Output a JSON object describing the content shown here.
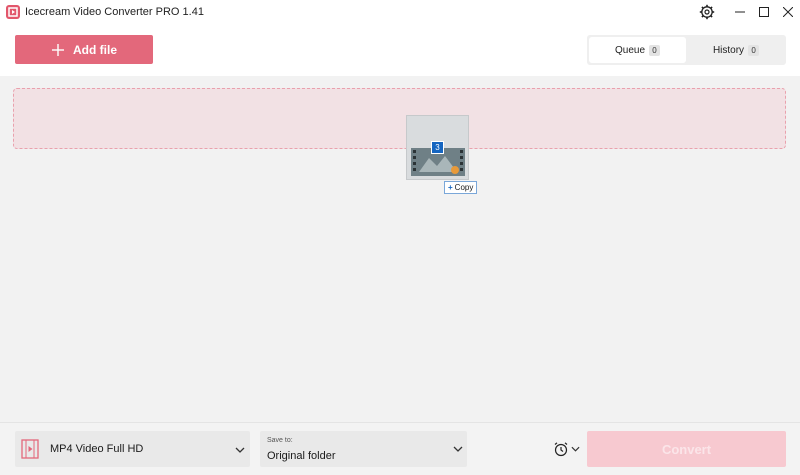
{
  "window": {
    "title": "Icecream Video Converter PRO 1.41",
    "settings_icon": "gear-icon",
    "controls": [
      "minimize-icon",
      "maximize-icon",
      "close-icon"
    ]
  },
  "header": {
    "add_file_label": "Add file",
    "tabs": [
      {
        "label": "Queue",
        "count": "0",
        "active": true
      },
      {
        "label": "History",
        "count": "0",
        "active": false
      }
    ]
  },
  "drag": {
    "item_count": "3",
    "action_label": "Copy"
  },
  "footer": {
    "format_value": "MP4 Video Full HD",
    "save_caption": "Save to:",
    "save_value": "Original folder",
    "schedule_icon": "alarm-clock-icon",
    "convert_label": "Convert"
  },
  "colors": {
    "accent": "#e3687b",
    "dropzone_bg": "#f2e1e4",
    "dropzone_border": "#e9a1ad",
    "convert_disabled": "#f7c9d0"
  }
}
